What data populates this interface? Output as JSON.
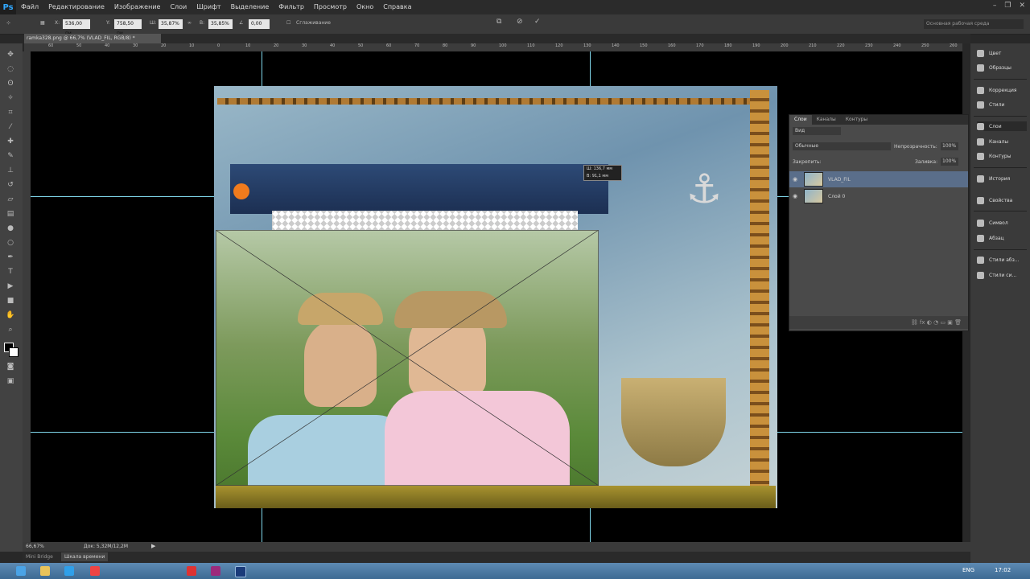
{
  "menubar": {
    "logo": "Ps",
    "items": [
      "Файл",
      "Редактирование",
      "Изображение",
      "Слои",
      "Шрифт",
      "Выделение",
      "Фильтр",
      "Просмотр",
      "Окно",
      "Справка"
    ],
    "window_controls": [
      "–",
      "❐",
      "✕"
    ]
  },
  "options_bar": {
    "x_label": "X:",
    "x_value": "536,00 пи",
    "y_label": "Y:",
    "y_value": "758,50 пи",
    "w_label": "Ш:",
    "w_value": "35,87%",
    "h_label": "В:",
    "h_value": "35,85%",
    "angle_value": "0,00",
    "antialias_label": "Сглаживание",
    "workspace": "Основная рабочая среда"
  },
  "document": {
    "tab_title": "ramka328.png @ 66,7% (VLAD_FIL, RGB/8) *",
    "ruler_ticks": [
      "60",
      "50",
      "40",
      "30",
      "20",
      "10",
      "0",
      "10",
      "20",
      "30",
      "40",
      "50",
      "60",
      "70",
      "80",
      "90",
      "100",
      "110",
      "120",
      "130",
      "140",
      "150",
      "160",
      "170",
      "180",
      "190",
      "200",
      "210",
      "220",
      "230",
      "240",
      "250",
      "260"
    ],
    "dimension_tip": {
      "w": "Ш: 136,7 мм",
      "h": "В: 91,1 мм"
    }
  },
  "status_bar": {
    "zoom": "66,67%",
    "doc_info": "Док: 5,32М/12,2М"
  },
  "timeline_tabs": [
    "Mini Bridge",
    "Шкала времени"
  ],
  "layers_panel": {
    "tabs": [
      "Слои",
      "Каналы",
      "Контуры"
    ],
    "filter": "Вид",
    "blend_mode": "Обычные",
    "opacity_label": "Непрозрачность:",
    "opacity_value": "100%",
    "lock_label": "Закрепить:",
    "fill_label": "Заливка:",
    "fill_value": "100%",
    "layers": [
      {
        "name": "VLAD_FIL",
        "selected": true
      },
      {
        "name": "Слой 0",
        "selected": false
      }
    ]
  },
  "panel_strip": {
    "items": [
      "Цвет",
      "Образцы",
      "Коррекция",
      "Стили",
      "Слои",
      "Каналы",
      "Контуры",
      "История",
      "Свойства",
      "Символ",
      "Абзац",
      "Стили абз...",
      "Стили си..."
    ]
  },
  "taskbar": {
    "lang": "ENG",
    "time": "17:02"
  },
  "colors": {
    "guide": "#7fd6ea",
    "selected_layer": "#5a6e8a"
  }
}
